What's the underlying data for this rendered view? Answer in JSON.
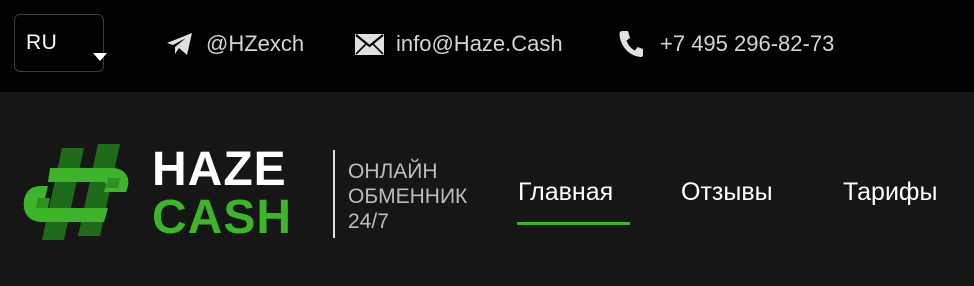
{
  "topbar": {
    "language": "RU",
    "contacts": {
      "telegram": "@HZexch",
      "email": "info@Haze.Cash",
      "phone": "+7 495 296-82-73"
    }
  },
  "header": {
    "brand": {
      "line1": "HAZE",
      "line2": "CASH"
    },
    "tagline": [
      "ОНЛАЙН",
      "ОБМЕННИК",
      "24/7"
    ],
    "nav": [
      {
        "label": "Главная",
        "active": true
      },
      {
        "label": "Отзывы",
        "active": false
      },
      {
        "label": "Тарифы",
        "active": false
      }
    ]
  },
  "colors": {
    "topbar_bg": "#000000",
    "header_bg": "#161616",
    "accent_green": "#3db42a",
    "text_light": "#d4d4d4"
  },
  "icons": [
    "chevron-down-icon",
    "telegram-icon",
    "mail-icon",
    "phone-icon",
    "hashtag-logo-icon"
  ]
}
